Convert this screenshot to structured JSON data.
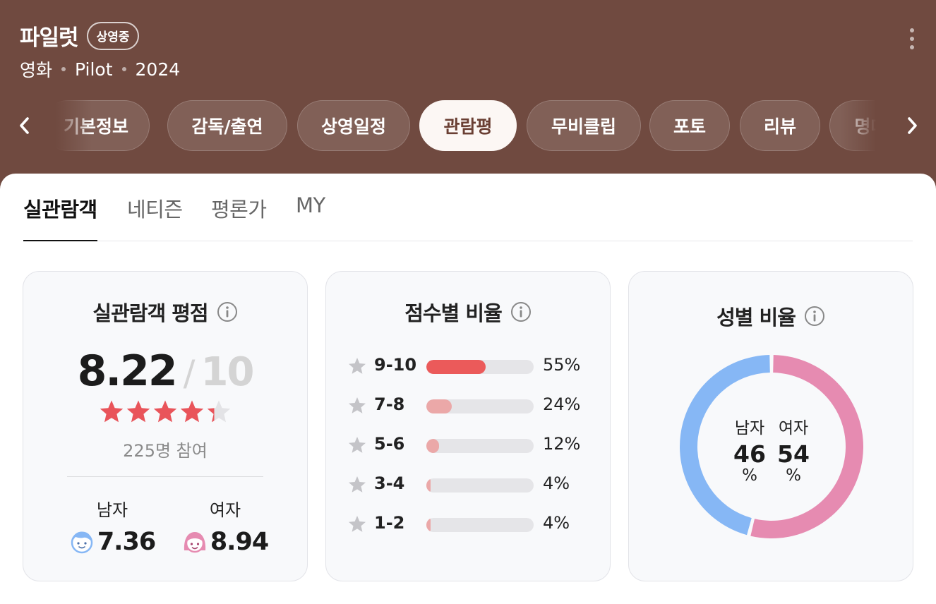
{
  "header": {
    "title": "파일럿",
    "badge": "상영중",
    "meta": [
      "영화",
      "Pilot",
      "2024"
    ]
  },
  "tabs": [
    {
      "label": "기본정보",
      "active": false
    },
    {
      "label": "감독/출연",
      "active": false
    },
    {
      "label": "상영일정",
      "active": false
    },
    {
      "label": "관람평",
      "active": true
    },
    {
      "label": "무비클립",
      "active": false
    },
    {
      "label": "포토",
      "active": false
    },
    {
      "label": "리뷰",
      "active": false
    },
    {
      "label": "명대사",
      "active": false
    }
  ],
  "subtabs": [
    {
      "label": "실관람객",
      "active": true
    },
    {
      "label": "네티즌",
      "active": false
    },
    {
      "label": "평론가",
      "active": false
    },
    {
      "label": "MY",
      "active": false
    }
  ],
  "rating_card": {
    "title": "실관람객 평점",
    "score": "8.22",
    "slash": "/",
    "max": "10",
    "stars_value": 4.3,
    "stars_total": 5,
    "participants": "225명 참여",
    "male_label": "남자",
    "male_score": "7.36",
    "female_label": "여자",
    "female_score": "8.94"
  },
  "distribution_card": {
    "title": "점수별 비율",
    "rows": [
      {
        "label": "9-10",
        "percent": 55,
        "percent_text": "55%"
      },
      {
        "label": "7-8",
        "percent": 24,
        "percent_text": "24%"
      },
      {
        "label": "5-6",
        "percent": 12,
        "percent_text": "12%"
      },
      {
        "label": "3-4",
        "percent": 4,
        "percent_text": "4%"
      },
      {
        "label": "1-2",
        "percent": 4,
        "percent_text": "4%"
      }
    ]
  },
  "gender_card": {
    "title": "성별 비율",
    "male_label": "남자",
    "male_value": "46",
    "female_label": "여자",
    "female_value": "54",
    "unit": "%",
    "male_percent": 46,
    "female_percent": 54
  },
  "colors": {
    "header_bg": "#704a40",
    "star_red": "#e9545a",
    "bar_top": "#eb5a5a",
    "bar_other": "#eba8a8",
    "male_blue": "#86b7f5",
    "female_pink": "#e68bb1"
  },
  "icons": [
    "more-vertical-icon",
    "chevron-left-icon",
    "chevron-right-icon",
    "info-icon",
    "star-icon",
    "male-avatar-icon",
    "female-avatar-icon"
  ]
}
